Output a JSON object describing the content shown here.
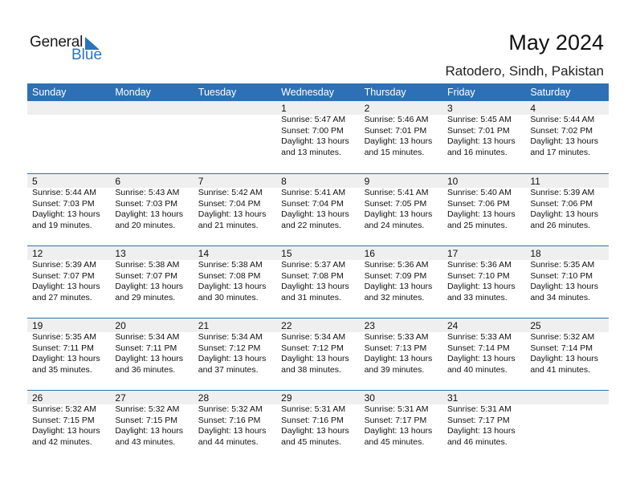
{
  "logo": {
    "general": "General",
    "blue": "Blue"
  },
  "header": {
    "title": "May 2024",
    "location": "Ratodero, Sindh, Pakistan"
  },
  "colors": {
    "accent": "#2e70b5",
    "band": "#efefef"
  },
  "weekdays": [
    "Sunday",
    "Monday",
    "Tuesday",
    "Wednesday",
    "Thursday",
    "Friday",
    "Saturday"
  ],
  "weeks": [
    [
      null,
      null,
      null,
      {
        "day": "1",
        "sunrise": "Sunrise: 5:47 AM",
        "sunset": "Sunset: 7:00 PM",
        "daylight1": "Daylight: 13 hours",
        "daylight2": "and 13 minutes."
      },
      {
        "day": "2",
        "sunrise": "Sunrise: 5:46 AM",
        "sunset": "Sunset: 7:01 PM",
        "daylight1": "Daylight: 13 hours",
        "daylight2": "and 15 minutes."
      },
      {
        "day": "3",
        "sunrise": "Sunrise: 5:45 AM",
        "sunset": "Sunset: 7:01 PM",
        "daylight1": "Daylight: 13 hours",
        "daylight2": "and 16 minutes."
      },
      {
        "day": "4",
        "sunrise": "Sunrise: 5:44 AM",
        "sunset": "Sunset: 7:02 PM",
        "daylight1": "Daylight: 13 hours",
        "daylight2": "and 17 minutes."
      }
    ],
    [
      {
        "day": "5",
        "sunrise": "Sunrise: 5:44 AM",
        "sunset": "Sunset: 7:03 PM",
        "daylight1": "Daylight: 13 hours",
        "daylight2": "and 19 minutes."
      },
      {
        "day": "6",
        "sunrise": "Sunrise: 5:43 AM",
        "sunset": "Sunset: 7:03 PM",
        "daylight1": "Daylight: 13 hours",
        "daylight2": "and 20 minutes."
      },
      {
        "day": "7",
        "sunrise": "Sunrise: 5:42 AM",
        "sunset": "Sunset: 7:04 PM",
        "daylight1": "Daylight: 13 hours",
        "daylight2": "and 21 minutes."
      },
      {
        "day": "8",
        "sunrise": "Sunrise: 5:41 AM",
        "sunset": "Sunset: 7:04 PM",
        "daylight1": "Daylight: 13 hours",
        "daylight2": "and 22 minutes."
      },
      {
        "day": "9",
        "sunrise": "Sunrise: 5:41 AM",
        "sunset": "Sunset: 7:05 PM",
        "daylight1": "Daylight: 13 hours",
        "daylight2": "and 24 minutes."
      },
      {
        "day": "10",
        "sunrise": "Sunrise: 5:40 AM",
        "sunset": "Sunset: 7:06 PM",
        "daylight1": "Daylight: 13 hours",
        "daylight2": "and 25 minutes."
      },
      {
        "day": "11",
        "sunrise": "Sunrise: 5:39 AM",
        "sunset": "Sunset: 7:06 PM",
        "daylight1": "Daylight: 13 hours",
        "daylight2": "and 26 minutes."
      }
    ],
    [
      {
        "day": "12",
        "sunrise": "Sunrise: 5:39 AM",
        "sunset": "Sunset: 7:07 PM",
        "daylight1": "Daylight: 13 hours",
        "daylight2": "and 27 minutes."
      },
      {
        "day": "13",
        "sunrise": "Sunrise: 5:38 AM",
        "sunset": "Sunset: 7:07 PM",
        "daylight1": "Daylight: 13 hours",
        "daylight2": "and 29 minutes."
      },
      {
        "day": "14",
        "sunrise": "Sunrise: 5:38 AM",
        "sunset": "Sunset: 7:08 PM",
        "daylight1": "Daylight: 13 hours",
        "daylight2": "and 30 minutes."
      },
      {
        "day": "15",
        "sunrise": "Sunrise: 5:37 AM",
        "sunset": "Sunset: 7:08 PM",
        "daylight1": "Daylight: 13 hours",
        "daylight2": "and 31 minutes."
      },
      {
        "day": "16",
        "sunrise": "Sunrise: 5:36 AM",
        "sunset": "Sunset: 7:09 PM",
        "daylight1": "Daylight: 13 hours",
        "daylight2": "and 32 minutes."
      },
      {
        "day": "17",
        "sunrise": "Sunrise: 5:36 AM",
        "sunset": "Sunset: 7:10 PM",
        "daylight1": "Daylight: 13 hours",
        "daylight2": "and 33 minutes."
      },
      {
        "day": "18",
        "sunrise": "Sunrise: 5:35 AM",
        "sunset": "Sunset: 7:10 PM",
        "daylight1": "Daylight: 13 hours",
        "daylight2": "and 34 minutes."
      }
    ],
    [
      {
        "day": "19",
        "sunrise": "Sunrise: 5:35 AM",
        "sunset": "Sunset: 7:11 PM",
        "daylight1": "Daylight: 13 hours",
        "daylight2": "and 35 minutes."
      },
      {
        "day": "20",
        "sunrise": "Sunrise: 5:34 AM",
        "sunset": "Sunset: 7:11 PM",
        "daylight1": "Daylight: 13 hours",
        "daylight2": "and 36 minutes."
      },
      {
        "day": "21",
        "sunrise": "Sunrise: 5:34 AM",
        "sunset": "Sunset: 7:12 PM",
        "daylight1": "Daylight: 13 hours",
        "daylight2": "and 37 minutes."
      },
      {
        "day": "22",
        "sunrise": "Sunrise: 5:34 AM",
        "sunset": "Sunset: 7:12 PM",
        "daylight1": "Daylight: 13 hours",
        "daylight2": "and 38 minutes."
      },
      {
        "day": "23",
        "sunrise": "Sunrise: 5:33 AM",
        "sunset": "Sunset: 7:13 PM",
        "daylight1": "Daylight: 13 hours",
        "daylight2": "and 39 minutes."
      },
      {
        "day": "24",
        "sunrise": "Sunrise: 5:33 AM",
        "sunset": "Sunset: 7:14 PM",
        "daylight1": "Daylight: 13 hours",
        "daylight2": "and 40 minutes."
      },
      {
        "day": "25",
        "sunrise": "Sunrise: 5:32 AM",
        "sunset": "Sunset: 7:14 PM",
        "daylight1": "Daylight: 13 hours",
        "daylight2": "and 41 minutes."
      }
    ],
    [
      {
        "day": "26",
        "sunrise": "Sunrise: 5:32 AM",
        "sunset": "Sunset: 7:15 PM",
        "daylight1": "Daylight: 13 hours",
        "daylight2": "and 42 minutes."
      },
      {
        "day": "27",
        "sunrise": "Sunrise: 5:32 AM",
        "sunset": "Sunset: 7:15 PM",
        "daylight1": "Daylight: 13 hours",
        "daylight2": "and 43 minutes."
      },
      {
        "day": "28",
        "sunrise": "Sunrise: 5:32 AM",
        "sunset": "Sunset: 7:16 PM",
        "daylight1": "Daylight: 13 hours",
        "daylight2": "and 44 minutes."
      },
      {
        "day": "29",
        "sunrise": "Sunrise: 5:31 AM",
        "sunset": "Sunset: 7:16 PM",
        "daylight1": "Daylight: 13 hours",
        "daylight2": "and 45 minutes."
      },
      {
        "day": "30",
        "sunrise": "Sunrise: 5:31 AM",
        "sunset": "Sunset: 7:17 PM",
        "daylight1": "Daylight: 13 hours",
        "daylight2": "and 45 minutes."
      },
      {
        "day": "31",
        "sunrise": "Sunrise: 5:31 AM",
        "sunset": "Sunset: 7:17 PM",
        "daylight1": "Daylight: 13 hours",
        "daylight2": "and 46 minutes."
      },
      null
    ]
  ]
}
